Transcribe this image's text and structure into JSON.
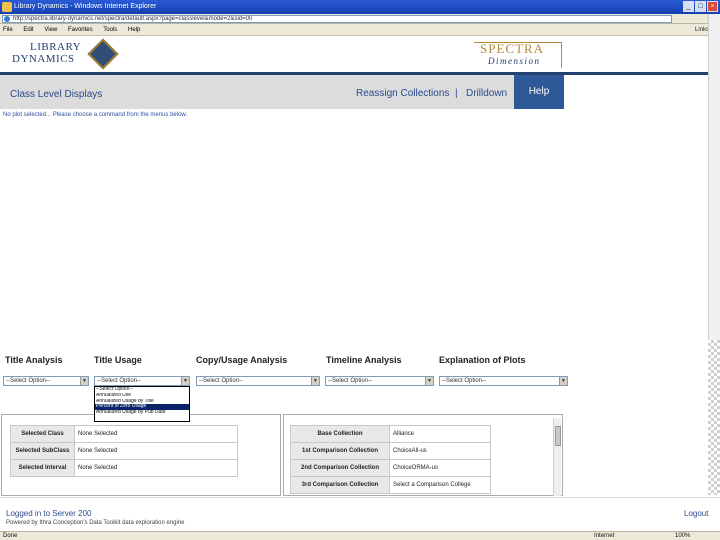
{
  "window": {
    "title": "Library Dynamics - Windows Internet Explorer",
    "address": "http://spectra.library-dynamics.net/spectra/default.aspx?page=classlevel&mode=2&sid=00"
  },
  "menubar": {
    "items": [
      "File",
      "Edit",
      "View",
      "Favorites",
      "Tools",
      "Help"
    ],
    "right_label": "Links »"
  },
  "brand": {
    "ld_line1": "LIBRARY",
    "ld_line2": "DYNAMICS",
    "sd_line1": "SPECTRA",
    "sd_line2": "Dimension"
  },
  "nav": {
    "title": "Class Level Displays",
    "reassign": "Reassign Collections",
    "separator": "|",
    "drilldown": "Drilldown",
    "help": "Help"
  },
  "message": "No plot selected... Please choose a command from the menus below.",
  "menus": [
    {
      "label": "Title Analysis",
      "value": "--Select Option--"
    },
    {
      "label": "Title Usage",
      "value": "--Select Option--"
    },
    {
      "label": "Copy/Usage Analysis",
      "value": "--Select Option--"
    },
    {
      "label": "Timeline Analysis",
      "value": "--Select Option--"
    },
    {
      "label": "Explanation of Plots",
      "value": "--Select Option--"
    }
  ],
  "open_dropdown": {
    "options": [
      "--Select Option--",
      "Annualized Use",
      "Annualized Usage by Title",
      "Percent of Zero Usage",
      "Annualized Usage by Pub Date"
    ],
    "selected_index": 3
  },
  "left_table": [
    {
      "label": "Selected Class",
      "value": "None Selected"
    },
    {
      "label": "Selected SubClass",
      "value": "None Selected"
    },
    {
      "label": "Selected Interval",
      "value": "None Selected"
    }
  ],
  "right_table": [
    {
      "label": "Base Collection",
      "value": "Alliance"
    },
    {
      "label": "1st Comparison Collection",
      "value": "ChoiceAll-us"
    },
    {
      "label": "2nd Comparison Collection",
      "value": "ChoiceORMA-us"
    },
    {
      "label": "3rd Comparison Collection",
      "value": "Select a Comparison College"
    }
  ],
  "footer": {
    "logged": "Logged in to Server 200",
    "powered": "Powered by Ithra Conception's Data Toolkit data exploration engine",
    "logout": "Logout"
  },
  "status": {
    "done": "Done",
    "zone": "Internet",
    "zoom": "100%"
  }
}
